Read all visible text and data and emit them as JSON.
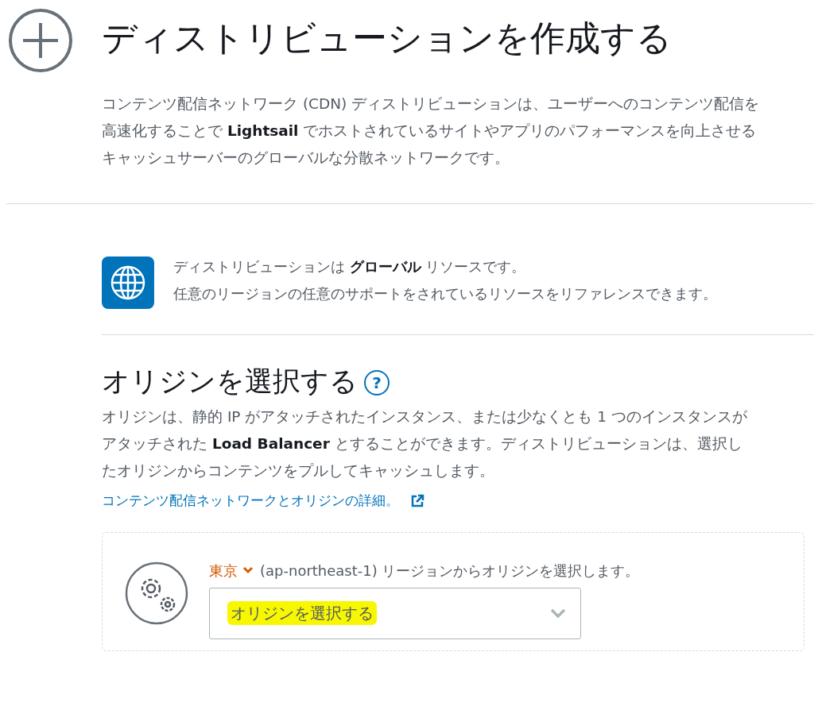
{
  "header": {
    "title": "ディストリビューションを作成する",
    "description": "コンテンツ配信ネットワーク (CDN) ディストリビューションは、ユーザーへのコンテンツ配信を高速化することで **Lightsail** でホストされているサイトやアプリのパフォーマンスを向上させるキャッシュサーバーのグローバルな分散ネットワークです。"
  },
  "notice": {
    "line_1": "ディストリビューションは **グローバル** リソースです。",
    "line_2": "任意のリージョンの任意のサポートをされているリソースをリファレンスできます。"
  },
  "origin": {
    "heading": "オリジンを選択する",
    "help": "?",
    "description": "オリジンは、静的 IP がアタッチされたインスタンス、または少なくとも 1 つのインスタンスがアタッチされた **Load Balancer** とすることができます。ディストリビューションは、選択したオリジンからコンテンツをプルしてキャッシュします。",
    "link": "コンテンツ配信ネットワークとオリジンの詳細。",
    "region": "東京",
    "region_text": "(ap-northeast-1) リージョンからオリジンを選択します。",
    "select": {
      "placeholder": "オリジンを選択する",
      "highlighted": true
    }
  }
}
